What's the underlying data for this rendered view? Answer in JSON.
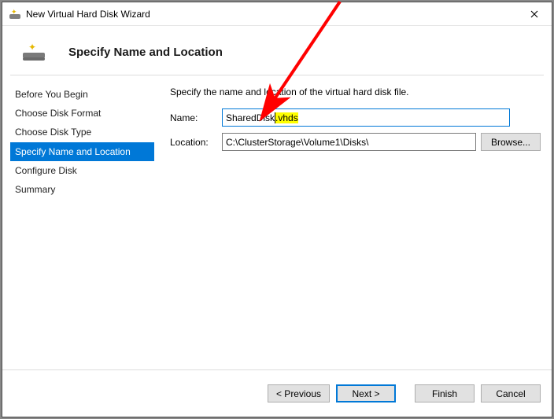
{
  "window": {
    "title": "New Virtual Hard Disk Wizard"
  },
  "page": {
    "heading": "Specify Name and Location",
    "instruction": "Specify the name and location of the virtual hard disk file."
  },
  "sidebar": {
    "steps": [
      {
        "label": "Before You Begin"
      },
      {
        "label": "Choose Disk Format"
      },
      {
        "label": "Choose Disk Type"
      },
      {
        "label": "Specify Name and Location"
      },
      {
        "label": "Configure Disk"
      },
      {
        "label": "Summary"
      }
    ],
    "active_index": 3
  },
  "form": {
    "name_label": "Name:",
    "name_prefix": "SharedDisk",
    "name_highlighted": ".vhds",
    "name_value": "SharedDisk.vhds",
    "location_label": "Location:",
    "location_value": "C:\\ClusterStorage\\Volume1\\Disks\\",
    "browse_label": "Browse..."
  },
  "footer": {
    "previous": "< Previous",
    "next": "Next >",
    "finish": "Finish",
    "cancel": "Cancel"
  },
  "annotation": {
    "arrow_color": "#ff0000"
  }
}
